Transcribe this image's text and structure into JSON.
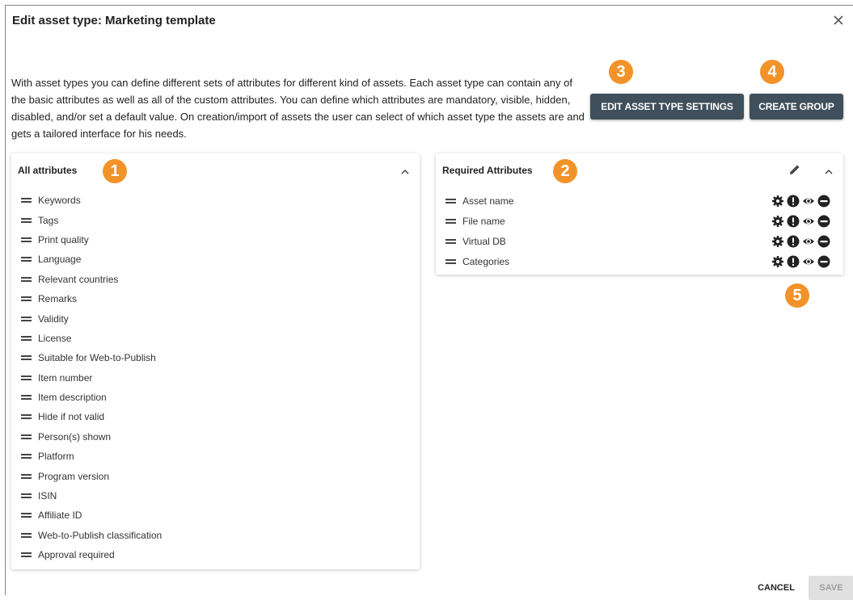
{
  "dialog": {
    "title": "Edit asset type: Marketing template",
    "description": "With asset types you can define different sets of attributes for different kind of assets. Each asset type can contain any of the basic attributes as well as all of the custom attributes. You can define which attributes are mandatory, visible, hidden, disabled, and/or set a default value. On creation/import of assets the user can select of which asset type the assets are and gets a tailored interface for his needs."
  },
  "buttons": {
    "edit_settings": "EDIT ASSET TYPE SETTINGS",
    "create_group": "CREATE GROUP",
    "cancel": "CANCEL",
    "save": "SAVE"
  },
  "badges": {
    "b1": "1",
    "b2": "2",
    "b3": "3",
    "b4": "4",
    "b5": "5"
  },
  "all_attributes": {
    "title": "All attributes",
    "items": [
      "Keywords",
      "Tags",
      "Print quality",
      "Language",
      "Relevant countries",
      "Remarks",
      "Validity",
      "License",
      "Suitable for Web-to-Publish",
      "Item number",
      "Item description",
      "Hide if not valid",
      "Person(s) shown",
      "Platform",
      "Program version",
      "ISIN",
      "Affiliate ID",
      "Web-to-Publish classification",
      "Approval required"
    ]
  },
  "required_attributes": {
    "title": "Required Attributes",
    "items": [
      "Asset name",
      "File name",
      "Virtual DB",
      "Categories"
    ]
  },
  "colors": {
    "accent": "#f2932a",
    "button": "#3f4f5b",
    "disabled_bg": "#e0e0e0"
  },
  "icons": [
    "close-icon",
    "chevron-up-icon",
    "pencil-icon",
    "gear-icon",
    "exclamation-icon",
    "eye-icon",
    "minus-circle-icon",
    "drag-handle-icon"
  ]
}
